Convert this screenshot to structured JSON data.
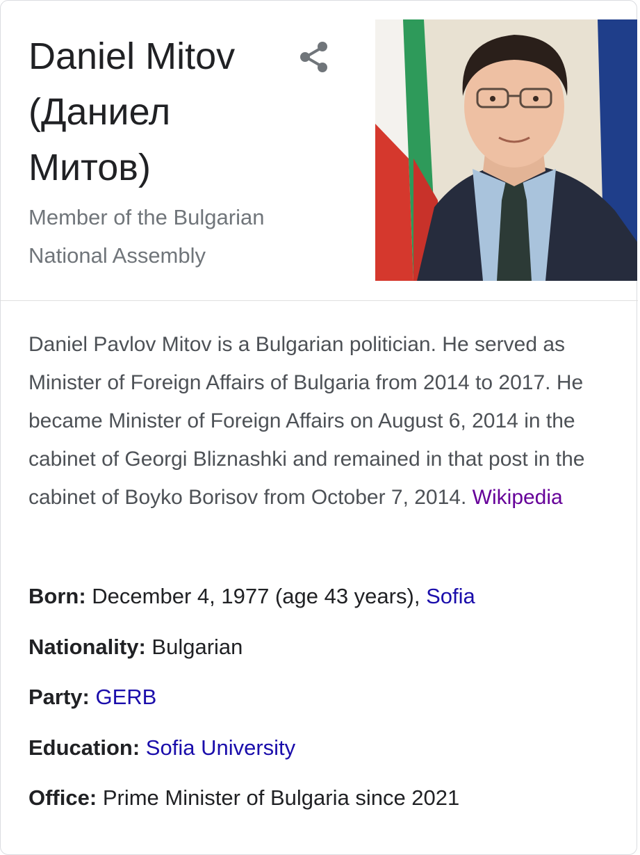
{
  "header": {
    "title_line1": "Daniel Mitov",
    "title_line2": "(Даниел",
    "title_line3": "Митов)",
    "subtitle_line1": "Member of the Bulgarian",
    "subtitle_line2": "National Assembly",
    "share_icon": "share-icon"
  },
  "description": {
    "text": "Daniel Pavlov Mitov is a Bulgarian politician. He served as Minister of Foreign Affairs of Bulgaria from 2014 to 2017. He became Minister of Foreign Affairs on August 6, 2014 in the cabinet of Georgi Bliznashki and remained in that post in the cabinet of Boyko Borisov from October 7, 2014.",
    "source_link": "Wikipedia"
  },
  "facts": {
    "born": {
      "label": "Born:",
      "value": "December 4, 1977 (age 43 years),",
      "link": "Sofia"
    },
    "nationality": {
      "label": "Nationality:",
      "value": "Bulgarian"
    },
    "party": {
      "label": "Party:",
      "link": "GERB"
    },
    "education": {
      "label": "Education:",
      "link": "Sofia University"
    },
    "office": {
      "label": "Office:",
      "value": "Prime Minister of Bulgaria since 2021"
    }
  },
  "colors": {
    "link": "#1a0dab",
    "visited_link": "#660099",
    "secondary_text": "#70757a",
    "body_text": "#4d5156",
    "border": "#dadce0"
  }
}
